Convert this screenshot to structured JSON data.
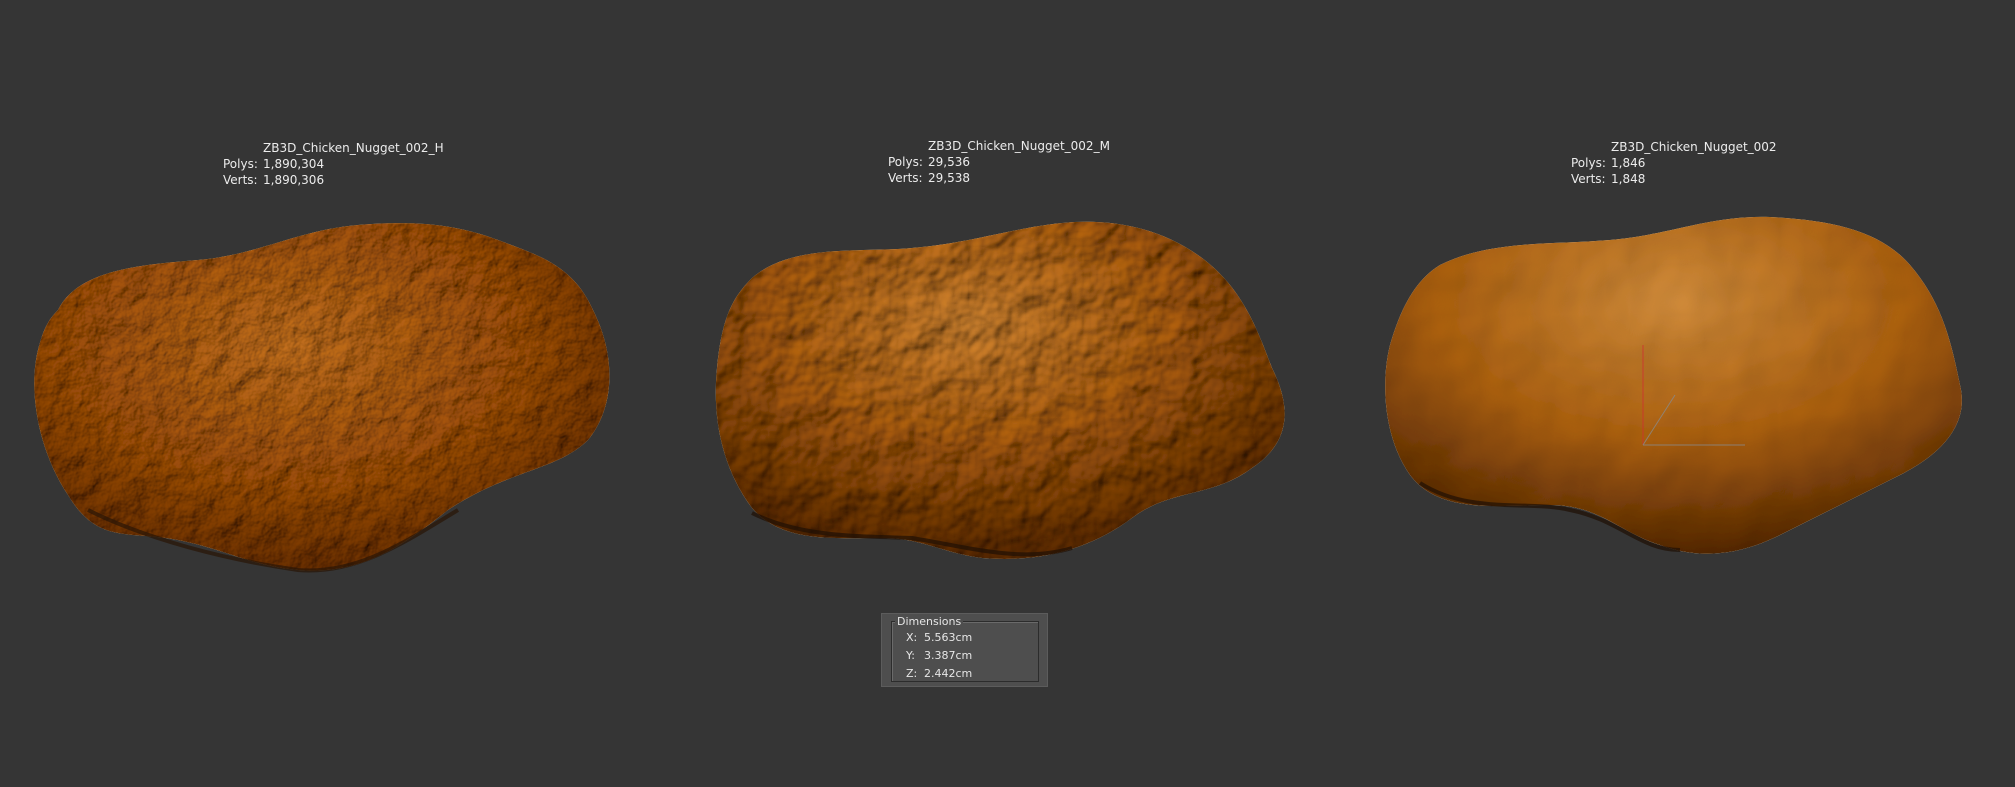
{
  "models": [
    {
      "name": "ZB3D_Chicken_Nugget_002_H",
      "polys_label": "Polys:",
      "polys": "1,890,304",
      "verts_label": "Verts:",
      "verts": "1,890,306"
    },
    {
      "name": "ZB3D_Chicken_Nugget_002_M",
      "polys_label": "Polys:",
      "polys": "29,536",
      "verts_label": "Verts:",
      "verts": "29,538"
    },
    {
      "name": "ZB3D_Chicken_Nugget_002",
      "polys_label": "Polys:",
      "polys": "1,846",
      "verts_label": "Verts:",
      "verts": "1,848"
    }
  ],
  "dimensions": {
    "title": "Dimensions",
    "x_label": "X:",
    "x": "5.563cm",
    "y_label": "Y:",
    "y": "3.387cm",
    "z_label": "Z:",
    "z": "2.442cm"
  },
  "colors": {
    "background": "#353535",
    "nugget_base": "#b8761f",
    "nugget_highlight": "#e0a65a",
    "nugget_shadow": "#5a3208"
  }
}
